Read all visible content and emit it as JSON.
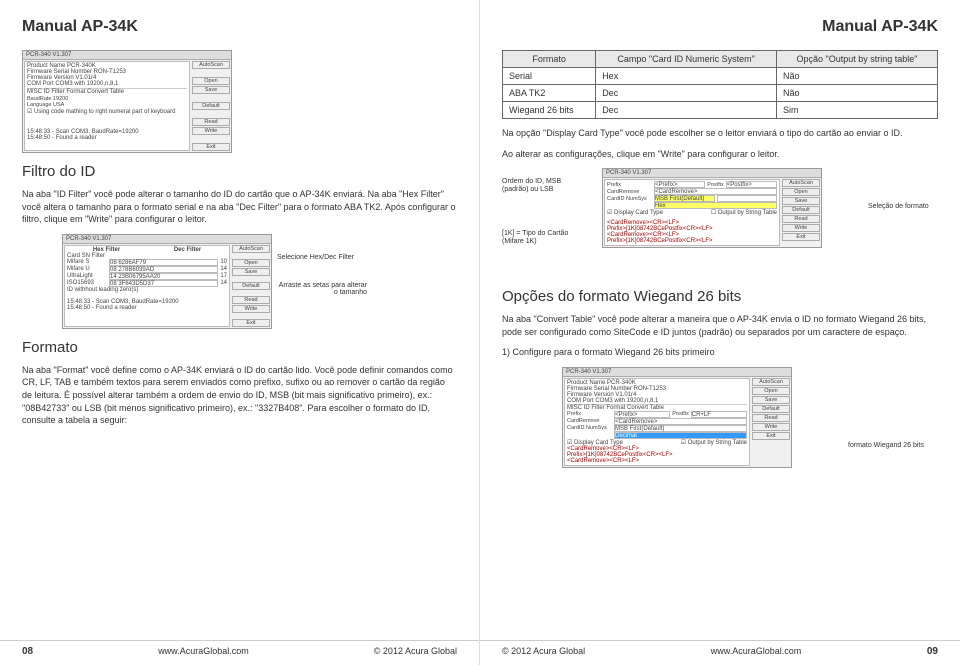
{
  "doc_title": "Manual AP-34K",
  "left": {
    "section1_title": "Filtro do ID",
    "section1_para": "Na aba \"ID Filter\" você pode alterar o tamanho do ID do cartão que o AP-34K enviará. Na aba \"Hex Filter\" você altera o tamanho para o formato serial e na aba \"Dec Filter\" para o formato ABA TK2. Após configurar o filtro, clique em \"Write\" para configurar o leitor.",
    "fig_anno_select": "Selecione Hex/Dec Filter",
    "fig_anno_drag": "Arraste as setas para alterar o tamanho",
    "section2_title": "Formato",
    "section2_para": "Na aba \"Format\" você define como o AP-34K enviará o ID do cartão lido. Você pode definir comandos como CR, LF, TAB e também textos para serem enviados como prefixo, sufixo ou ao remover o cartão da região de leitura. É possível alterar também a ordem de envio do ID, MSB (bit mais significativo primeiro), ex.: \"08B42733\" ou LSB (bit menos significativo primeiro), ex.: \"3327B408\". Para escolher o formato do ID, consulte a tabela a seguir:",
    "page_num": "08",
    "url": "www.AcuraGlobal.com",
    "copyright": "© 2012 Acura Global",
    "screenshot1": {
      "title": "PCR-340 V1.307",
      "lines": [
        "Product Name PCR-340K",
        "Firmware Serial Number RON-T1253",
        "Firmware Version V1.01r4",
        "COM Port COM3 with 19200,n,8,1",
        "MISC ID Filter  Format  Convert Table",
        "BaudRate  19200",
        "Language  USA",
        "☑ Using code mathing to right numeral part of keyboard",
        "15:48:33 - Scan COM3, BaudRate=19200",
        "15:48:50 - Found a reader"
      ],
      "btns": [
        "AutoScan",
        "Open",
        "Save",
        "Default",
        "Read",
        "Write",
        "Exit"
      ]
    },
    "screenshot2": {
      "title": "PCR-340 V1.307",
      "hexcol": "Hex Filter",
      "deccol": "Dec Filter",
      "rows": [
        [
          "Card SN Filter",
          "",
          ""
        ],
        [
          "Mifare S",
          "08 6286AF79",
          "10",
          ""
        ],
        [
          "Mifare U",
          "08 278B6039AD",
          "14",
          ""
        ],
        [
          "UltraLight",
          "14 23B06795AA20",
          "17",
          ""
        ],
        [
          "ISO15693",
          "08 3F643D5D37",
          "14",
          ""
        ]
      ],
      "bottom": "ID withhout leading zero(s)",
      "status": [
        "15:48:33 - Scan COM3, BaudRate=19200",
        "15:48:50 - Found a reader"
      ],
      "btns": [
        "AutoScan",
        "Open",
        "Save",
        "Default",
        "Read",
        "Write",
        "Exit"
      ]
    }
  },
  "right": {
    "table": {
      "h1": "Formato",
      "h2": "Campo \"Card ID Numeric System\"",
      "h3": "Opção \"Output by string table\"",
      "rows": [
        [
          "Serial",
          "Hex",
          "Não"
        ],
        [
          "ABA TK2",
          "Dec",
          "Não"
        ],
        [
          "Wiegand 26 bits",
          "Dec",
          "Sim"
        ]
      ]
    },
    "para1": "Na opção \"Display Card Type\" você pode escolher se o leitor enviará o tipo do cartão ao enviar o ID.",
    "para2": "Ao alterar as configurações, clique em \"Write\" para configurar o leitor.",
    "anno_order": "Ordem do ID, MSB (padrão) ou LSB",
    "anno_type": "[1K] = Tipo do Cartão (Mifare 1K)",
    "anno_sel": "Seleção de formato",
    "section_title": "Opções do formato Wiegand 26 bits",
    "para3": "Na aba \"Convert Table\" você pode alterar a maneira que o AP-34K envia o ID no formato Wiegand 26 bits, pode ser configurado como SiteCode e ID juntos (padrão) ou separados por um caractere de espaço.",
    "step1": "1) Configure para o formato Wiegand 26 bits primeiro",
    "anno_wieg": "formato Wiegand 26 bits",
    "page_num": "09",
    "url": "www.AcuraGlobal.com",
    "copyright": "© 2012 Acura Global",
    "screenshot_r1": {
      "title": "PCR-340 V1.307",
      "rows": [
        [
          "Prefix",
          "<Prefix>",
          "Postfix",
          "<Postfix>"
        ],
        [
          "CardRemove",
          "<CardRemove>",
          "",
          ""
        ],
        [
          "CardID NumSys",
          "MSB First(Default)",
          "MSB First(Default)",
          ""
        ],
        [
          "",
          "Hex",
          "",
          ""
        ],
        [
          "☑ Display Card Type",
          "",
          "☐ Output by String Table",
          ""
        ]
      ],
      "bottom": [
        "<CardRemove><CR><LF>",
        "Prefix>[1K]08742BCePostfix<CR><LF>",
        "<CardRemove><CR><LF>",
        "Prefix>[1K]08742BCePostfix<CR><LF>"
      ],
      "btns": [
        "AutoScan",
        "Open",
        "Save",
        "Default",
        "Read",
        "Write",
        "Exit"
      ]
    },
    "screenshot_r2": {
      "title": "PCR-340 V1.307",
      "header": [
        "Product Name PCR-340K",
        "Firmware Serial Number RON-T1253",
        "Firmware Version V1.01r4",
        "COM Port COM3 with 19200,n,8,1",
        "MISC ID Filter Format Convert Table"
      ],
      "rows": [
        [
          "Prefix",
          "<Prefix>",
          "Postfix",
          "CR+LF"
        ],
        [
          "CardRemove",
          "<CardRemove>",
          "",
          ""
        ],
        [
          "CardID NumSys",
          "MSB First(Default)",
          "MSB First(Default)",
          ""
        ],
        [
          "",
          "Decimal",
          "",
          ""
        ],
        [
          "☑ Display Card Type",
          "",
          "☑ Output by String Table",
          ""
        ]
      ],
      "bottom": [
        "<CardRemove><CR><LF>",
        "Prefix>[1K]08742BCePostfix<CR><LF>",
        "<CardRemove><CR><LF>"
      ],
      "btns": [
        "AutoScan",
        "Open",
        "Save",
        "Default",
        "Read",
        "Write",
        "Exit"
      ]
    }
  }
}
